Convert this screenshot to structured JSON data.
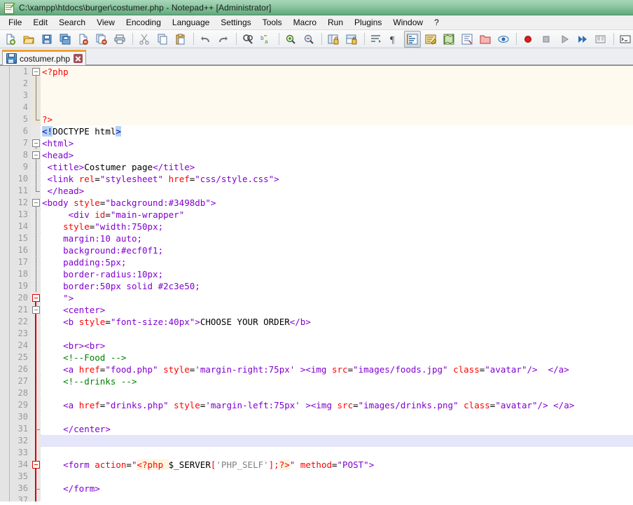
{
  "window": {
    "title": "C:\\xampp\\htdocs\\burger\\costumer.php - Notepad++ [Administrator]",
    "app_icon": "notepad-plus-plus-icon",
    "titlebar_color": "#8cc7a1"
  },
  "menubar": {
    "items": [
      {
        "label": "File"
      },
      {
        "label": "Edit"
      },
      {
        "label": "Search"
      },
      {
        "label": "View"
      },
      {
        "label": "Encoding"
      },
      {
        "label": "Language"
      },
      {
        "label": "Settings"
      },
      {
        "label": "Tools"
      },
      {
        "label": "Macro"
      },
      {
        "label": "Run"
      },
      {
        "label": "Plugins"
      },
      {
        "label": "Window"
      },
      {
        "label": "?"
      }
    ]
  },
  "toolbar": {
    "buttons": [
      {
        "icon": "new-file-icon"
      },
      {
        "icon": "open-file-icon"
      },
      {
        "icon": "save-icon"
      },
      {
        "icon": "save-all-icon"
      },
      {
        "icon": "close-file-icon"
      },
      {
        "icon": "close-all-icon"
      },
      {
        "icon": "print-icon"
      },
      {
        "icon": "separator"
      },
      {
        "icon": "cut-icon"
      },
      {
        "icon": "copy-icon"
      },
      {
        "icon": "paste-icon"
      },
      {
        "icon": "separator"
      },
      {
        "icon": "undo-icon"
      },
      {
        "icon": "redo-icon"
      },
      {
        "icon": "separator"
      },
      {
        "icon": "find-icon"
      },
      {
        "icon": "replace-icon"
      },
      {
        "icon": "separator"
      },
      {
        "icon": "zoom-in-icon"
      },
      {
        "icon": "zoom-out-icon"
      },
      {
        "icon": "separator"
      },
      {
        "icon": "sync-vertical-scroll-icon"
      },
      {
        "icon": "sync-horizontal-scroll-icon"
      },
      {
        "icon": "separator"
      },
      {
        "icon": "word-wrap-icon"
      },
      {
        "icon": "show-all-characters-icon"
      },
      {
        "icon": "indent-guide-icon"
      },
      {
        "icon": "user-defined-language-icon"
      },
      {
        "icon": "document-map-icon"
      },
      {
        "icon": "function-list-icon"
      },
      {
        "icon": "folder-as-workspace-icon"
      },
      {
        "icon": "monitoring-icon"
      },
      {
        "icon": "separator"
      },
      {
        "icon": "macro-record-icon"
      },
      {
        "icon": "macro-stop-icon"
      },
      {
        "icon": "macro-play-icon"
      },
      {
        "icon": "macro-run-multiple-icon"
      },
      {
        "icon": "macro-save-icon"
      },
      {
        "icon": "separator"
      },
      {
        "icon": "run-console-icon"
      }
    ]
  },
  "tabs": [
    {
      "label": "costumer.php",
      "icon": "saved-file-icon",
      "close_icon": "close-icon",
      "active": true
    }
  ],
  "editor": {
    "first_line": 1,
    "lines": [
      {
        "n": 1,
        "fold": "open-red-top",
        "php": true,
        "caret": false
      },
      {
        "n": 2,
        "fold": "line-grey",
        "php": true,
        "caret": false
      },
      {
        "n": 3,
        "fold": "line-grey",
        "php": true,
        "caret": false
      },
      {
        "n": 4,
        "fold": "line-grey",
        "php": true,
        "caret": false
      },
      {
        "n": 5,
        "fold": "end-grey",
        "php": true,
        "caret": false
      },
      {
        "n": 6,
        "fold": "none",
        "php": false,
        "caret": false
      },
      {
        "n": 7,
        "fold": "open-grey",
        "php": false,
        "caret": false
      },
      {
        "n": 8,
        "fold": "open-grey",
        "php": false,
        "caret": false
      },
      {
        "n": 9,
        "fold": "line-grey",
        "php": false,
        "caret": false
      },
      {
        "n": 10,
        "fold": "line-grey",
        "php": false,
        "caret": false
      },
      {
        "n": 11,
        "fold": "end-grey",
        "php": false,
        "caret": false
      },
      {
        "n": 12,
        "fold": "open-grey",
        "php": false,
        "caret": false
      },
      {
        "n": 13,
        "fold": "line-grey",
        "php": false,
        "caret": false
      },
      {
        "n": 14,
        "fold": "line-grey",
        "php": false,
        "caret": false
      },
      {
        "n": 15,
        "fold": "line-grey",
        "php": false,
        "caret": false
      },
      {
        "n": 16,
        "fold": "line-grey",
        "php": false,
        "caret": false
      },
      {
        "n": 17,
        "fold": "line-grey",
        "php": false,
        "caret": false
      },
      {
        "n": 18,
        "fold": "line-grey",
        "php": false,
        "caret": false
      },
      {
        "n": 19,
        "fold": "line-grey",
        "php": false,
        "caret": false
      },
      {
        "n": 20,
        "fold": "open-red",
        "php": false,
        "caret": false
      },
      {
        "n": 21,
        "fold": "open-grey-red",
        "php": false,
        "caret": false
      },
      {
        "n": 22,
        "fold": "line-red",
        "php": false,
        "caret": false
      },
      {
        "n": 23,
        "fold": "line-red",
        "php": false,
        "caret": false
      },
      {
        "n": 24,
        "fold": "line-red",
        "php": false,
        "caret": false
      },
      {
        "n": 25,
        "fold": "line-red",
        "php": false,
        "caret": false
      },
      {
        "n": 26,
        "fold": "line-red",
        "php": false,
        "caret": false
      },
      {
        "n": 27,
        "fold": "line-red",
        "php": false,
        "caret": false
      },
      {
        "n": 28,
        "fold": "line-red",
        "php": false,
        "caret": false
      },
      {
        "n": 29,
        "fold": "line-red",
        "php": false,
        "caret": false
      },
      {
        "n": 30,
        "fold": "line-red",
        "php": false,
        "caret": false
      },
      {
        "n": 31,
        "fold": "end-red",
        "php": false,
        "caret": false
      },
      {
        "n": 32,
        "fold": "line-red",
        "php": false,
        "caret": true
      },
      {
        "n": 33,
        "fold": "line-red",
        "php": false,
        "caret": false
      },
      {
        "n": 34,
        "fold": "open-red2",
        "php": false,
        "caret": false
      },
      {
        "n": 35,
        "fold": "line-red",
        "php": false,
        "caret": false
      },
      {
        "n": 36,
        "fold": "end-red2",
        "php": false,
        "caret": false
      },
      {
        "n": 37,
        "fold": "line-red",
        "php": false,
        "caret": false
      }
    ],
    "code_lines": [
      [
        {
          "t": "<?php",
          "c": "php"
        }
      ],
      [],
      [],
      [],
      [
        {
          "t": "?>",
          "c": "php"
        }
      ],
      [
        {
          "t": "<!",
          "c": "tag mark"
        },
        {
          "t": "DOCTYPE html",
          "c": "txt"
        },
        {
          "t": ">",
          "c": "tag mark"
        }
      ],
      [
        {
          "t": "<html>",
          "c": "tagn"
        }
      ],
      [
        {
          "t": "<head>",
          "c": "tagn"
        }
      ],
      [
        {
          "t": " ",
          "c": "txt"
        },
        {
          "t": "<title>",
          "c": "tagn"
        },
        {
          "t": "Costumer page",
          "c": "txt"
        },
        {
          "t": "</title>",
          "c": "tagn"
        }
      ],
      [
        {
          "t": " ",
          "c": "txt"
        },
        {
          "t": "<link ",
          "c": "tagn"
        },
        {
          "t": "rel",
          "c": "attr"
        },
        {
          "t": "=",
          "c": "txt"
        },
        {
          "t": "\"stylesheet\"",
          "c": "val"
        },
        {
          "t": " ",
          "c": "txt"
        },
        {
          "t": "href",
          "c": "attr"
        },
        {
          "t": "=",
          "c": "txt"
        },
        {
          "t": "\"css/style.css\"",
          "c": "val"
        },
        {
          "t": ">",
          "c": "tagn"
        }
      ],
      [
        {
          "t": " ",
          "c": "txt"
        },
        {
          "t": "</head>",
          "c": "tagn"
        }
      ],
      [
        {
          "t": "<body ",
          "c": "tagn"
        },
        {
          "t": "style",
          "c": "attr"
        },
        {
          "t": "=",
          "c": "txt"
        },
        {
          "t": "\"background:#3498db\"",
          "c": "val"
        },
        {
          "t": ">",
          "c": "tagn"
        }
      ],
      [
        {
          "t": "     ",
          "c": "txt"
        },
        {
          "t": "<div ",
          "c": "tagn"
        },
        {
          "t": "id",
          "c": "attr"
        },
        {
          "t": "=",
          "c": "txt"
        },
        {
          "t": "\"main-wrapper\"",
          "c": "val"
        }
      ],
      [
        {
          "t": "    ",
          "c": "txt"
        },
        {
          "t": "style",
          "c": "attr"
        },
        {
          "t": "=",
          "c": "txt"
        },
        {
          "t": "\"width:750px;",
          "c": "val"
        }
      ],
      [
        {
          "t": "    ",
          "c": "txt"
        },
        {
          "t": "margin:10 auto;",
          "c": "val"
        }
      ],
      [
        {
          "t": "    ",
          "c": "txt"
        },
        {
          "t": "background:#ecf0f1;",
          "c": "val"
        }
      ],
      [
        {
          "t": "    ",
          "c": "txt"
        },
        {
          "t": "padding:5px;",
          "c": "val"
        }
      ],
      [
        {
          "t": "    ",
          "c": "txt"
        },
        {
          "t": "border-radius:10px;",
          "c": "val"
        }
      ],
      [
        {
          "t": "    ",
          "c": "txt"
        },
        {
          "t": "border:50px solid #2c3e50;",
          "c": "val"
        }
      ],
      [
        {
          "t": "    ",
          "c": "txt"
        },
        {
          "t": "\">",
          "c": "val"
        }
      ],
      [
        {
          "t": "    ",
          "c": "txt"
        },
        {
          "t": "<center>",
          "c": "tagn"
        }
      ],
      [
        {
          "t": "    ",
          "c": "txt"
        },
        {
          "t": "<b ",
          "c": "tagn"
        },
        {
          "t": "style",
          "c": "attr"
        },
        {
          "t": "=",
          "c": "txt"
        },
        {
          "t": "\"font-size:40px\"",
          "c": "val"
        },
        {
          "t": ">",
          "c": "tagn"
        },
        {
          "t": "CHOOSE YOUR ORDER",
          "c": "txt"
        },
        {
          "t": "</b>",
          "c": "tagn"
        }
      ],
      [],
      [
        {
          "t": "    ",
          "c": "txt"
        },
        {
          "t": "<br><br>",
          "c": "tagn"
        }
      ],
      [
        {
          "t": "    ",
          "c": "txt"
        },
        {
          "t": "<!--Food -->",
          "c": "cmt"
        }
      ],
      [
        {
          "t": "    ",
          "c": "txt"
        },
        {
          "t": "<a ",
          "c": "tagn"
        },
        {
          "t": "href",
          "c": "attr"
        },
        {
          "t": "=",
          "c": "txt"
        },
        {
          "t": "\"food.php\"",
          "c": "val"
        },
        {
          "t": " ",
          "c": "txt"
        },
        {
          "t": "style",
          "c": "attr"
        },
        {
          "t": "=",
          "c": "txt"
        },
        {
          "t": "'margin-right:75px'",
          "c": "val"
        },
        {
          "t": " >",
          "c": "tagn"
        },
        {
          "t": "<img ",
          "c": "tagn"
        },
        {
          "t": "src",
          "c": "attr"
        },
        {
          "t": "=",
          "c": "txt"
        },
        {
          "t": "\"images/foods.jpg\"",
          "c": "val"
        },
        {
          "t": " ",
          "c": "txt"
        },
        {
          "t": "class",
          "c": "attr"
        },
        {
          "t": "=",
          "c": "txt"
        },
        {
          "t": "\"avatar\"",
          "c": "val"
        },
        {
          "t": "/>",
          "c": "tagn"
        },
        {
          "t": "  ",
          "c": "txt"
        },
        {
          "t": "</a>",
          "c": "tagn"
        }
      ],
      [
        {
          "t": "    ",
          "c": "txt"
        },
        {
          "t": "<!--drinks -->",
          "c": "cmt"
        }
      ],
      [],
      [
        {
          "t": "    ",
          "c": "txt"
        },
        {
          "t": "<a ",
          "c": "tagn"
        },
        {
          "t": "href",
          "c": "attr"
        },
        {
          "t": "=",
          "c": "txt"
        },
        {
          "t": "\"drinks.php\"",
          "c": "val"
        },
        {
          "t": " ",
          "c": "txt"
        },
        {
          "t": "style",
          "c": "attr"
        },
        {
          "t": "=",
          "c": "txt"
        },
        {
          "t": "'margin-left:75px'",
          "c": "val"
        },
        {
          "t": " >",
          "c": "tagn"
        },
        {
          "t": "<img ",
          "c": "tagn"
        },
        {
          "t": "src",
          "c": "attr"
        },
        {
          "t": "=",
          "c": "txt"
        },
        {
          "t": "\"images/drinks.png\"",
          "c": "val"
        },
        {
          "t": " ",
          "c": "txt"
        },
        {
          "t": "class",
          "c": "attr"
        },
        {
          "t": "=",
          "c": "txt"
        },
        {
          "t": "\"avatar\"",
          "c": "val"
        },
        {
          "t": "/>",
          "c": "tagn"
        },
        {
          "t": " ",
          "c": "txt"
        },
        {
          "t": "</a>",
          "c": "tagn"
        }
      ],
      [],
      [
        {
          "t": "    ",
          "c": "txt"
        },
        {
          "t": "</center>",
          "c": "tagn"
        }
      ],
      [],
      [],
      [
        {
          "t": "    ",
          "c": "txt"
        },
        {
          "t": "<form ",
          "c": "tagn"
        },
        {
          "t": "action",
          "c": "attr"
        },
        {
          "t": "=",
          "c": "txt"
        },
        {
          "t": "\"",
          "c": "val"
        },
        {
          "t": "<?php ",
          "c": "php phpbg"
        },
        {
          "t": "$_SERVER",
          "c": "var"
        },
        {
          "t": "[",
          "c": "attr"
        },
        {
          "t": "'PHP_SELF'",
          "c": "str"
        },
        {
          "t": "];",
          "c": "attr"
        },
        {
          "t": "?>",
          "c": "php phpbg"
        },
        {
          "t": "\"",
          "c": "val"
        },
        {
          "t": " ",
          "c": "txt"
        },
        {
          "t": "method",
          "c": "attr"
        },
        {
          "t": "=",
          "c": "txt"
        },
        {
          "t": "\"POST\"",
          "c": "val"
        },
        {
          "t": ">",
          "c": "tagn"
        }
      ],
      [],
      [
        {
          "t": "    ",
          "c": "txt"
        },
        {
          "t": "</form>",
          "c": "tagn"
        }
      ],
      []
    ]
  }
}
